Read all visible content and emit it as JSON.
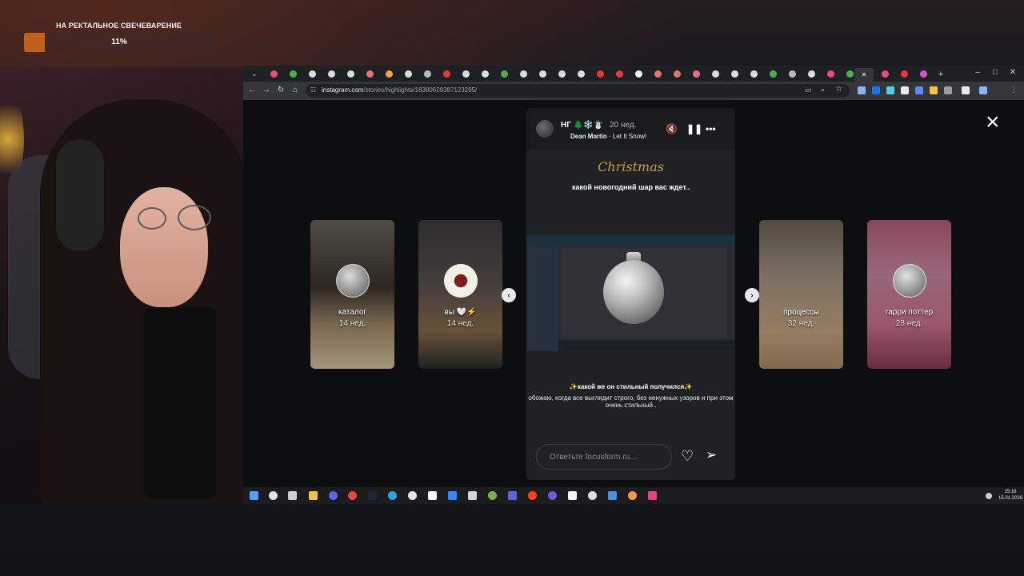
{
  "goal": {
    "title": "НА РЕКТАЛЬНОЕ СВЕЧЕВАРЕНИЕ",
    "percent_label": "11%",
    "progress": 0.11,
    "fill_color": "#c0601f"
  },
  "browser": {
    "url_host": "instagram.com",
    "url_path": "/stories/highlights/18380629387123295/",
    "tabs_count": 32,
    "window_controls": [
      "–",
      "□",
      "✕"
    ]
  },
  "viewer": {
    "close_icon": "close-icon",
    "prev_arrow": "‹",
    "next_arrow": "›",
    "side_stories": [
      {
        "label": "каталог",
        "age": "14 нед."
      },
      {
        "label": "вы 🤍⚡",
        "age": "14 нед."
      },
      {
        "label": "процессы",
        "age": "32 нед."
      },
      {
        "label": "гарри поттер",
        "age": "28 нед."
      }
    ],
    "story": {
      "username": "НГ 🌲❄️☃️",
      "time": "20 нед.",
      "artist": "Dean Martin",
      "song": "Let It Snow!",
      "christmas_logo": "Christmas",
      "caption_top": "какой новогодний шар вас ждет..",
      "caption_bottom_title": "✨какой же он стильный получился✨",
      "caption_bottom": "обожаю, когда все выглядит строго, без ненужных узоров и при этом очень стильный..",
      "reply_placeholder": "Ответьте focusform.ru..."
    }
  },
  "taskbar": {
    "time": "15:16",
    "date": "15.01.2026"
  }
}
